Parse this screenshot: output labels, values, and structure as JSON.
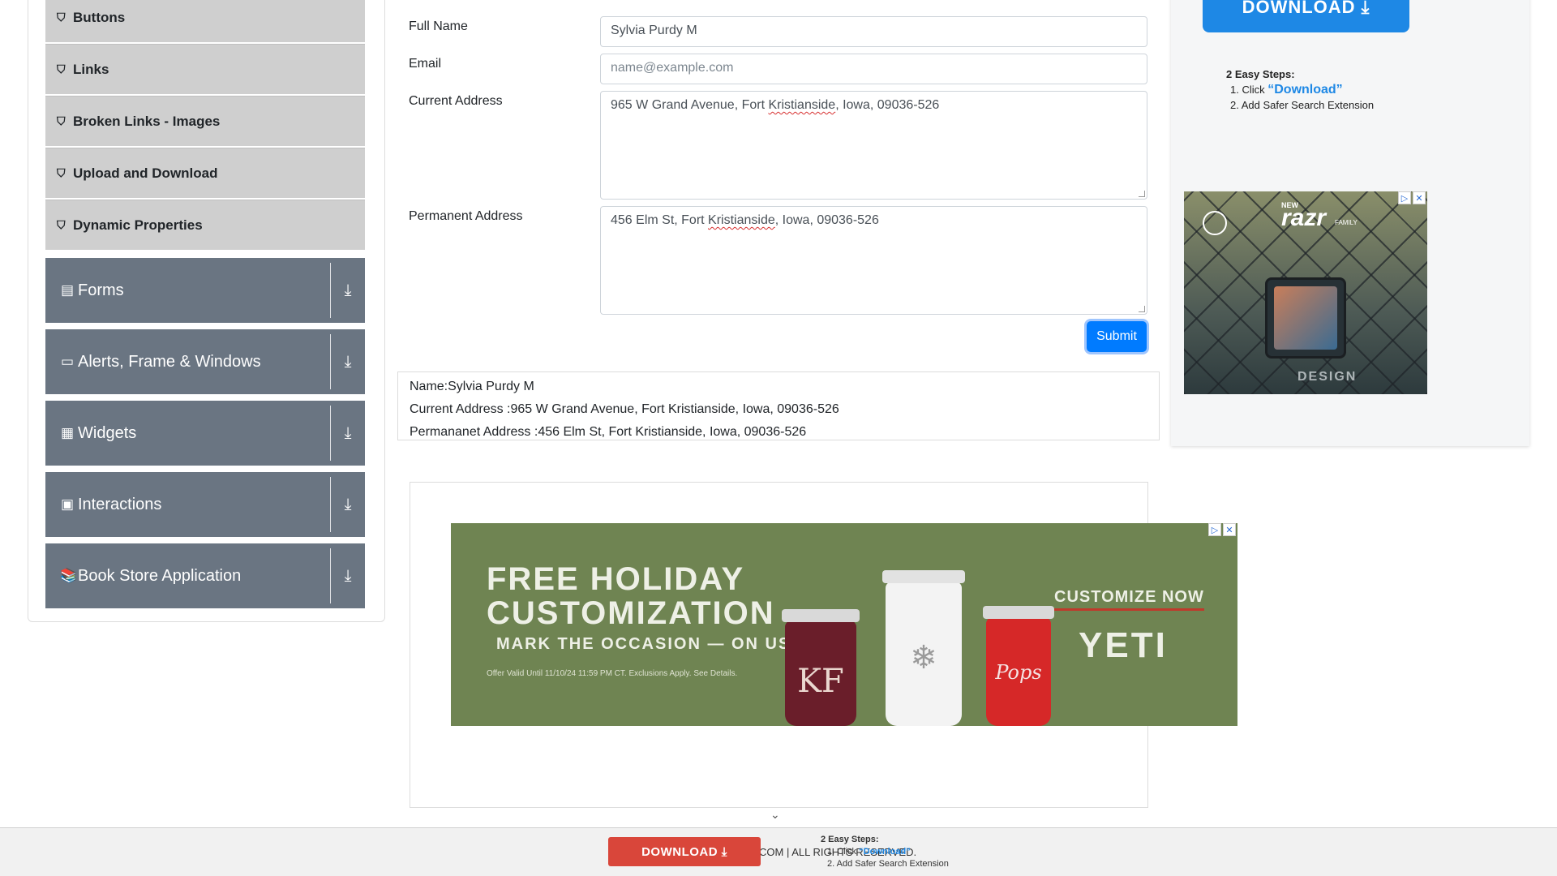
{
  "sidebar": {
    "sub_items": [
      {
        "label": "Buttons",
        "icon": "html5-icon"
      },
      {
        "label": "Links",
        "icon": "html5-icon"
      },
      {
        "label": "Broken Links - Images",
        "icon": "html5-icon"
      },
      {
        "label": "Upload and Download",
        "icon": "html5-icon"
      },
      {
        "label": "Dynamic Properties",
        "icon": "html5-icon"
      }
    ],
    "groups": [
      {
        "label": "Forms",
        "icon": "document-icon"
      },
      {
        "label": "Alerts, Frame & Windows",
        "icon": "window-icon"
      },
      {
        "label": "Widgets",
        "icon": "widgets-icon"
      },
      {
        "label": "Interactions",
        "icon": "interactions-icon"
      },
      {
        "label": "Book Store Application",
        "icon": "books-icon"
      }
    ]
  },
  "form": {
    "full_name_label": "Full Name",
    "full_name_value": "Sylvia Purdy M",
    "email_label": "Email",
    "email_placeholder": "name@example.com",
    "current_address_label": "Current Address",
    "current_address_value_pre": "965 W Grand Avenue, Fort ",
    "current_address_value_word": "Kristianside",
    "current_address_value_post": ", Iowa, 09036-526",
    "permanent_address_label": "Permanent Address",
    "permanent_address_value_pre": "456 Elm St, Fort ",
    "permanent_address_value_word": "Kristianside",
    "permanent_address_value_post": ", Iowa, 09036-526",
    "submit_label": "Submit"
  },
  "output": {
    "name": "Name:Sylvia Purdy M",
    "current_address": "Current Address :965 W Grand Avenue, Fort Kristianside, Iowa, 09036-526",
    "permanent_address": "Permananet Address :456 Elm St, Fort Kristianside, Iowa, 09036-526"
  },
  "ads": {
    "right_download_label": "DOWNLOAD ⤓",
    "steps_title": "2 Easy Steps:",
    "step1_prefix": "1. Click ",
    "step1_link": "“Download”",
    "step2": "2. Add Safer Search Extension",
    "razr_new": "NEW",
    "razr_logo": "razr",
    "razr_family": "FAMILY",
    "razr_design": "DESIGN",
    "yeti_headline_1": "FREE HOLIDAY",
    "yeti_headline_2": "CUSTOMIZATION",
    "yeti_subhead": "MARK THE OCCASION — ON US.",
    "yeti_fine": "Offer Valid Until 11/10/24 11:59 PM CT. Exclusions Apply. See Details.",
    "yeti_cta": "CUSTOMIZE NOW",
    "yeti_brand": "YETI",
    "cup1_text": "KF",
    "cup3_text": "Pops"
  },
  "footer": {
    "download_label": "DOWNLOAD ⤓",
    "copyright": "COM | ALL RIGHTS RESERVED.",
    "steps_title": "2 Easy Steps:",
    "step1_prefix": "1. Click ",
    "step1_link": "“Download”",
    "step2": "2. Add Safer Search Extension"
  },
  "colors": {
    "accent": "#007bff",
    "sidebar_group_bg": "#6a7582",
    "sub_item_bg": "#cfcfcf",
    "yeti_bg": "#6f8452"
  }
}
